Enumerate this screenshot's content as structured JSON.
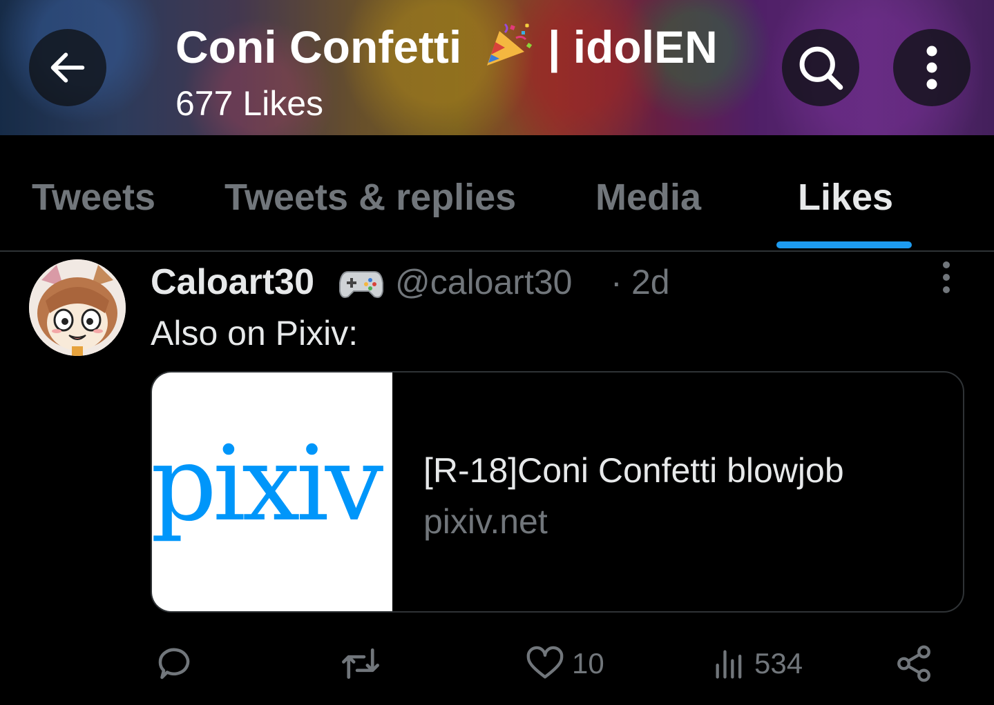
{
  "header": {
    "title_name": "Coni Confetti",
    "title_suffix": "| idolEN",
    "subtitle": "677 Likes",
    "title_icon": "party-popper-emoji"
  },
  "tabs": [
    {
      "label": "Tweets",
      "active": false
    },
    {
      "label": "Tweets & replies",
      "active": false
    },
    {
      "label": "Media",
      "active": false
    },
    {
      "label": "Likes",
      "active": true
    }
  ],
  "tweet": {
    "author_name": "Caloart30",
    "author_emoji": "gamepad-emoji",
    "handle": "@caloart30",
    "separator": "·",
    "time": "2d",
    "text": "Also on Pixiv:",
    "card": {
      "logo_text": "pixiv",
      "title": "[R-18]Coni Confetti blowjob",
      "domain": "pixiv.net"
    },
    "actions": {
      "reply_count": "",
      "retweet_count": "",
      "like_count": "10",
      "view_count": "534"
    }
  },
  "colors": {
    "accent": "#1d9bf0",
    "background": "#000000",
    "muted_text": "#71767b",
    "primary_text": "#e7e9ea",
    "pixiv_blue": "#0096fa"
  }
}
